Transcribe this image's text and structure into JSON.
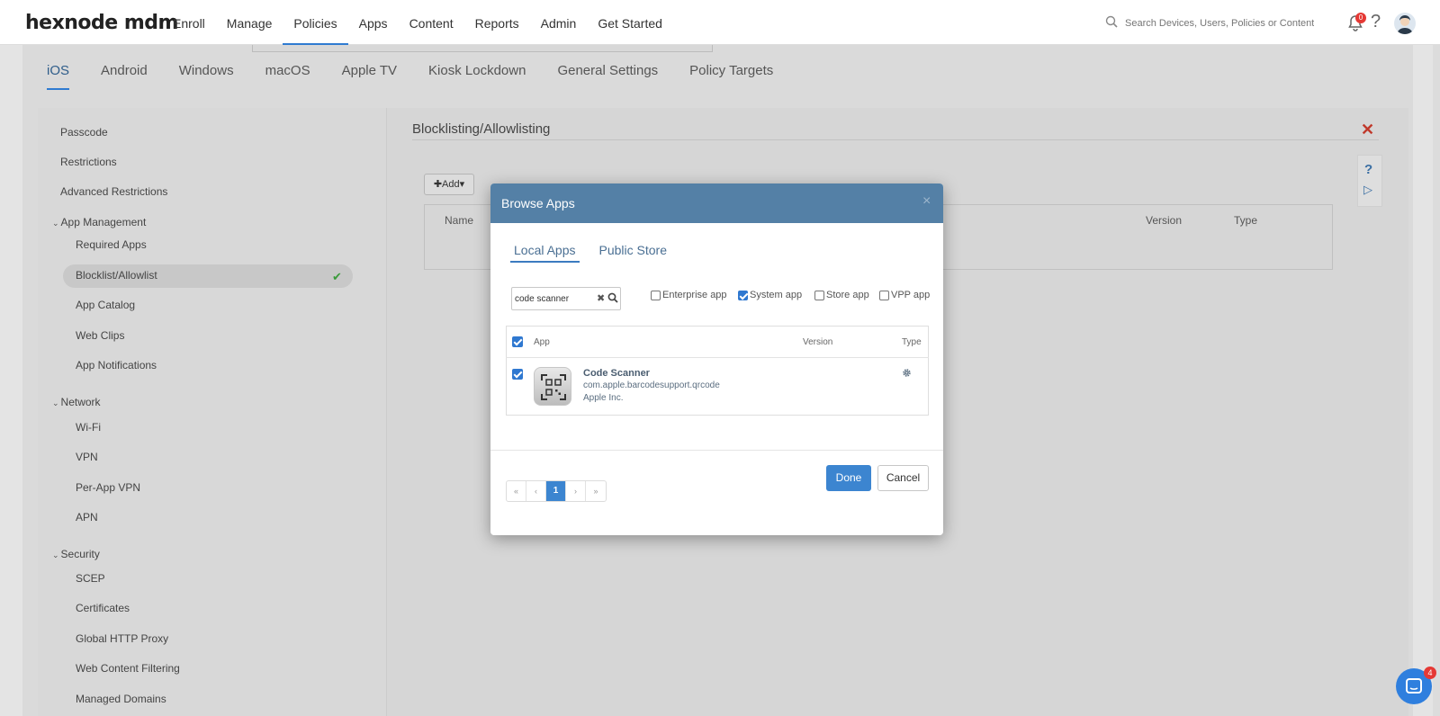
{
  "topbar": {
    "logo": "hexnode mdm",
    "nav": [
      "Enroll",
      "Manage",
      "Policies",
      "Apps",
      "Content",
      "Reports",
      "Admin",
      "Get Started"
    ],
    "active_nav": "Policies",
    "search_placeholder": "Search Devices, Users, Policies or Content",
    "notification_count": "0"
  },
  "os_tabs": [
    "iOS",
    "Android",
    "Windows",
    "macOS",
    "Apple TV",
    "Kiosk Lockdown",
    "General Settings",
    "Policy Targets"
  ],
  "sidebar": {
    "passcode": "Passcode",
    "restrictions": "Restrictions",
    "advanced_restrictions": "Advanced Restrictions",
    "app_management": "App Management",
    "required_apps": "Required Apps",
    "blocklist": "Blocklist/Allowlist",
    "app_catalog": "App Catalog",
    "web_clips": "Web Clips",
    "app_notifications": "App Notifications",
    "network": "Network",
    "wifi": "Wi-Fi",
    "vpn": "VPN",
    "per_app_vpn": "Per-App VPN",
    "apn": "APN",
    "security": "Security",
    "scep": "SCEP",
    "certificates": "Certificates",
    "global_http_proxy": "Global HTTP Proxy",
    "web_content_filtering": "Web Content Filtering",
    "managed_domains": "Managed Domains"
  },
  "main": {
    "section_title": "Blocklisting/Allowlisting",
    "add_label": "Add",
    "columns": {
      "name": "Name",
      "version": "Version",
      "type": "Type"
    }
  },
  "modal": {
    "title": "Browse Apps",
    "tabs": [
      "Local Apps",
      "Public Store"
    ],
    "search_value": "code scanner",
    "filters": [
      {
        "label": "Enterprise app",
        "checked": false
      },
      {
        "label": "System app",
        "checked": true
      },
      {
        "label": "Store app",
        "checked": false
      },
      {
        "label": "VPP app",
        "checked": false
      }
    ],
    "columns": {
      "app": "App",
      "version": "Version",
      "type": "Type"
    },
    "app": {
      "name": "Code Scanner",
      "bundle": "com.apple.barcodesupport.qrcode",
      "vendor": "Apple Inc."
    },
    "pager": [
      "«",
      "‹",
      "1",
      "›",
      "»"
    ],
    "done_label": "Done",
    "cancel_label": "Cancel"
  },
  "chat_badge": "4",
  "colors": {
    "accent": "#3c85d0",
    "modal_header": "#5480a6",
    "danger": "#c0392b"
  }
}
